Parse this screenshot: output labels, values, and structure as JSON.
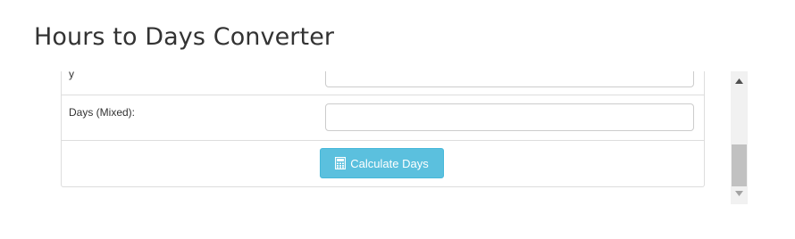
{
  "page": {
    "title": "Hours to Days Converter"
  },
  "form": {
    "partial_row": {
      "label": "y",
      "value": ""
    },
    "days_mixed": {
      "label": "Days (Mixed):",
      "value": ""
    },
    "calculate_button": {
      "label": "Calculate Days",
      "icon": "calculator-icon"
    }
  },
  "colors": {
    "button_bg": "#5bc0de",
    "button_border": "#46b8da",
    "border": "#dddddd",
    "title": "#333333",
    "scrollbar_track": "#f1f1f1",
    "scrollbar_thumb": "#c1c1c1"
  }
}
